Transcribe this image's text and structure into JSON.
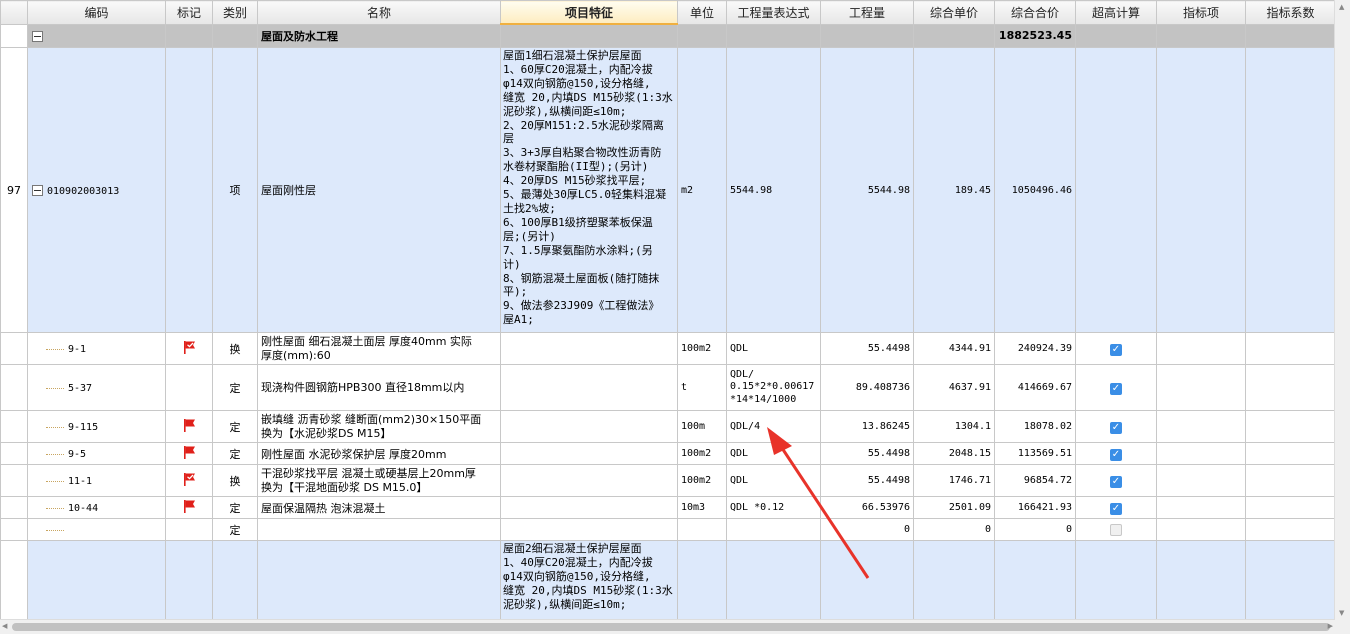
{
  "columns": [
    "编码",
    "标记",
    "类别",
    "名称",
    "项目特征",
    "单位",
    "工程量表达式",
    "工程量",
    "综合单价",
    "综合合价",
    "超高计算",
    "指标项",
    "指标系数"
  ],
  "group": {
    "name": "屋面及防水工程",
    "total": "1882523.45"
  },
  "main_item": {
    "row_no": "97",
    "code": "010902003013",
    "type": "项",
    "name": "屋面刚性层",
    "features": "屋面1细石混凝土保护层屋面\n1、60厚C20混凝土，内配冷拔\nφ14双向钢筋@150,设分格缝,\n缝宽 20,内填DS M15砂浆(1:3水\n泥砂浆),纵横间距≤10m;\n2、20厚M151:2.5水泥砂浆隔离\n层\n3、3+3厚自粘聚合物改性沥青防\n水卷材聚酯胎(II型);(另计)\n4、20厚DS M15砂浆找平层;\n5、最薄处30厚LC5.0轻集料混凝\n土找2%坡;\n6、100厚B1级挤塑聚苯板保温\n层;(另计)\n7、1.5厚聚氨酯防水涂料;(另\n计)\n8、钢筋混凝土屋面板(随打随抹\n平);\n9、做法参23J909《工程做法》\n屋A1;",
    "unit": "m2",
    "expr": "5544.98",
    "qty": "5544.98",
    "unit_price": "189.45",
    "total": "1050496.46"
  },
  "sub_items": [
    {
      "code": "9-1",
      "flag": "check-flag",
      "type": "换",
      "name": "刚性屋面 细石混凝土面层 厚度40mm  实际\n厚度(mm):60",
      "unit": "100m2",
      "expr": "QDL",
      "qty": "55.4498",
      "unit_price": "4344.91",
      "total": "240924.39",
      "checked": true
    },
    {
      "code": "5-37",
      "flag": "",
      "type": "定",
      "name": "现浇构件圆钢筋HPB300 直径18mm以内",
      "unit": "t",
      "expr": "QDL/\n0.15*2*0.00617\n*14*14/1000",
      "qty": "89.408736",
      "unit_price": "4637.91",
      "total": "414669.67",
      "checked": true
    },
    {
      "code": "9-115",
      "flag": "red-flag",
      "type": "定",
      "name": "嵌填缝 沥青砂浆 缝断面(mm2)30×150平面\n 换为【水泥砂浆DS M15】",
      "unit": "100m",
      "expr": "QDL/4",
      "qty": "13.86245",
      "unit_price": "1304.1",
      "total": "18078.02",
      "checked": true
    },
    {
      "code": "9-5",
      "flag": "red-flag",
      "type": "定",
      "name": "刚性屋面 水泥砂浆保护层 厚度20mm",
      "unit": "100m2",
      "expr": "QDL",
      "qty": "55.4498",
      "unit_price": "2048.15",
      "total": "113569.51",
      "checked": true
    },
    {
      "code": "11-1",
      "flag": "check-flag",
      "type": "换",
      "name": "干混砂浆找平层 混凝土或硬基层上20mm厚\n换为【干混地面砂浆 DS M15.0】",
      "unit": "100m2",
      "expr": "QDL",
      "qty": "55.4498",
      "unit_price": "1746.71",
      "total": "96854.72",
      "checked": true
    },
    {
      "code": "10-44",
      "flag": "red-flag",
      "type": "定",
      "name": "屋面保温隔热 泡沫混凝土",
      "unit": "10m3",
      "expr": "QDL *0.12",
      "qty": "66.53976",
      "unit_price": "2501.09",
      "total": "166421.93",
      "checked": true
    },
    {
      "code": "",
      "flag": "",
      "type": "定",
      "name": "",
      "unit": "",
      "expr": "",
      "qty": "0",
      "unit_price": "0",
      "total": "0",
      "checked": false
    }
  ],
  "next_item": {
    "features": "屋面2细石混凝土保护层屋面\n1、40厚C20混凝土，内配冷拔\nφ14双向钢筋@150,设分格缝,\n缝宽 20,内填DS M15砂浆(1:3水\n泥砂浆),纵横间距≤10m;"
  },
  "colors": {
    "header_highlight": "#fdecc0",
    "group_bg": "#c3c3c3",
    "item_bg": "#dde9fb",
    "arrow": "#e8332a",
    "flag": "#e0201a",
    "check": "#3a8ee6"
  }
}
